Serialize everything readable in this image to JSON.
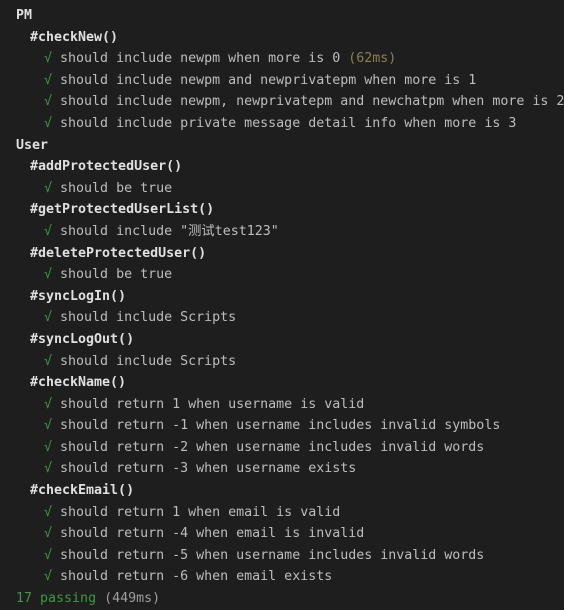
{
  "terminal": {
    "background_color": "#1e1e1e",
    "default_text_color": "#c4c4c4",
    "pass_color": "#3c9a40",
    "slow_duration_color": "#8b8150",
    "dim_color": "#9e9e9e",
    "suite_color": "#e0e0e0",
    "pass_symbol": "√"
  },
  "report": {
    "suites": [
      {
        "name": "PM",
        "sub_suites": [
          {
            "name": "#checkNew()",
            "tests": [
              {
                "title": "should include newpm when more is 0",
                "duration": "(62ms)",
                "duration_kind": "slow"
              },
              {
                "title": "should include newpm and newprivatepm when more is 1",
                "duration": "",
                "duration_kind": "none"
              },
              {
                "title": "should include newpm, newprivatepm and newchatpm when more is 2",
                "duration": "",
                "duration_kind": "none"
              },
              {
                "title": "should include private message detail info when more is 3",
                "duration": "",
                "duration_kind": "none"
              }
            ]
          }
        ]
      },
      {
        "name": "User",
        "sub_suites": [
          {
            "name": "#addProtectedUser()",
            "tests": [
              {
                "title": "should be true",
                "duration": "",
                "duration_kind": "none"
              }
            ]
          },
          {
            "name": "#getProtectedUserList()",
            "tests": [
              {
                "title": "should include \"测试test123\"",
                "duration": "",
                "duration_kind": "none"
              }
            ]
          },
          {
            "name": "#deleteProtectedUser()",
            "tests": [
              {
                "title": "should be true",
                "duration": "",
                "duration_kind": "none"
              }
            ]
          },
          {
            "name": "#syncLogIn()",
            "tests": [
              {
                "title": "should include Scripts",
                "duration": "",
                "duration_kind": "none"
              }
            ]
          },
          {
            "name": "#syncLogOut()",
            "tests": [
              {
                "title": "should include Scripts",
                "duration": "",
                "duration_kind": "none"
              }
            ]
          },
          {
            "name": "#checkName()",
            "tests": [
              {
                "title": "should return 1 when username is valid",
                "duration": "",
                "duration_kind": "none"
              },
              {
                "title": "should return -1 when username includes invalid symbols",
                "duration": "",
                "duration_kind": "none"
              },
              {
                "title": "should return -2 when username includes invalid words",
                "duration": "",
                "duration_kind": "none"
              },
              {
                "title": "should return -3 when username exists",
                "duration": "",
                "duration_kind": "none"
              }
            ]
          },
          {
            "name": "#checkEmail()",
            "tests": [
              {
                "title": "should return 1 when email is valid",
                "duration": "",
                "duration_kind": "none"
              },
              {
                "title": "should return -4 when email is invalid",
                "duration": "",
                "duration_kind": "none"
              },
              {
                "title": "should return -5 when username includes invalid words",
                "duration": "",
                "duration_kind": "none"
              },
              {
                "title": "should return -6 when email exists",
                "duration": "",
                "duration_kind": "none"
              }
            ]
          }
        ]
      }
    ],
    "summary": {
      "count": "17",
      "label": "passing",
      "duration": "(449ms)"
    }
  }
}
